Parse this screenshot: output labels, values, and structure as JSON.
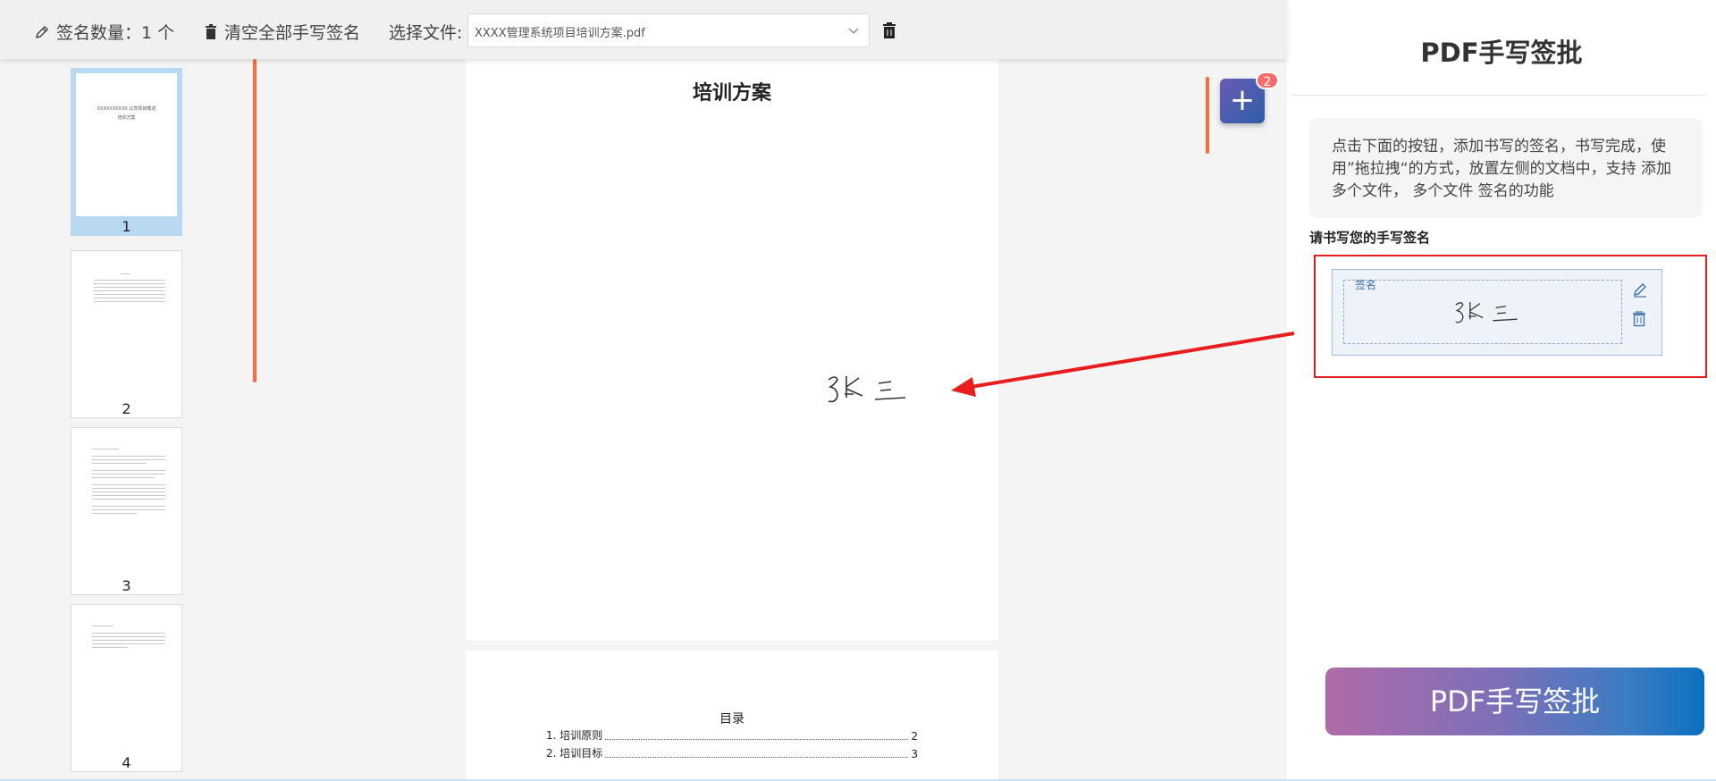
{
  "toolbar": {
    "sig_count_label": "签名数量：1 个",
    "clear_label": "清空全部手写签名",
    "file_label": "选择文件:",
    "file_value": "XXXX管理系统项目培训方案.pdf"
  },
  "thumbnails": [
    {
      "number": "1",
      "lines": [
        "XXXXXXXXXX 公司项目概述",
        "培训方案"
      ]
    },
    {
      "number": "2"
    },
    {
      "number": "3"
    },
    {
      "number": "4"
    }
  ],
  "document": {
    "page1_title": "培训方案",
    "toc_title": "目录",
    "toc_items": [
      {
        "label": "1. 培训原则",
        "page": "2"
      },
      {
        "label": "2. 培训目标",
        "page": "3"
      }
    ],
    "placed_signature": "张三"
  },
  "floating": {
    "add_label": "+",
    "badge_count": "2"
  },
  "panel": {
    "title": "PDF手写签批",
    "instructions": "点击下面的按钮，添加书写的签名，书写完成，使用”拖拉拽“的方式，放置左侧的文档中，支持 添加多个文件， 多个文件 签名的功能",
    "signature_prompt": "请书写您的手写签名",
    "signature_card_label": "签名",
    "signature_text": "张三",
    "action_button": "PDF手写签批"
  },
  "colors": {
    "accent_orange": "#ff6a3d",
    "highlight_red": "#e81e1e",
    "button_gradient_start": "#b06aa8",
    "button_gradient_end": "#0a70c0"
  }
}
